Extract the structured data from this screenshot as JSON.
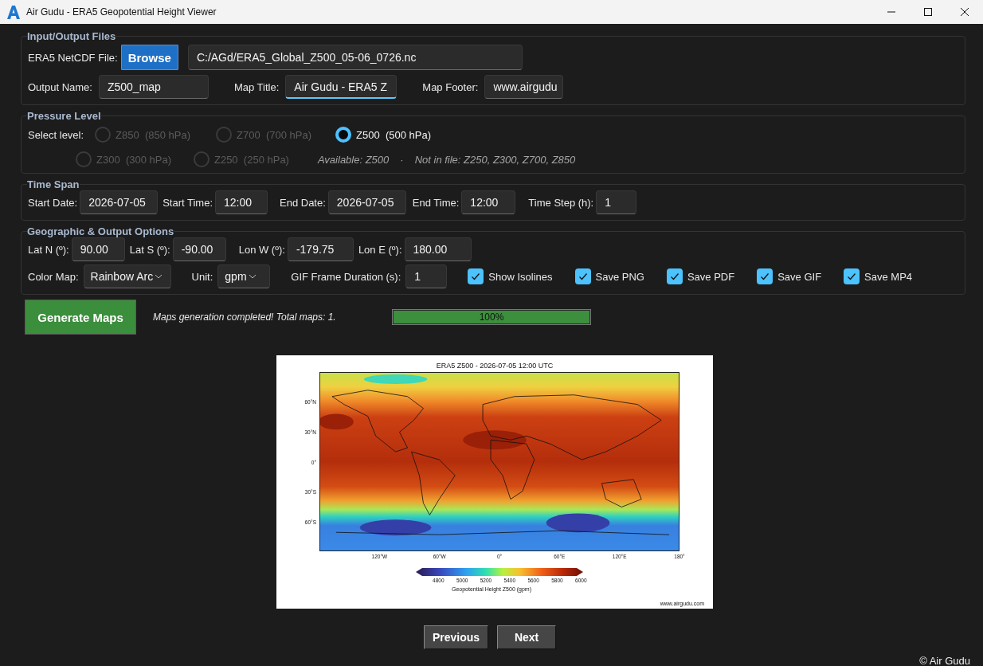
{
  "window": {
    "title": "Air Gudu - ERA5 Geopotential Height Viewer"
  },
  "input_output": {
    "title": "Input/Output Files",
    "file_label": "ERA5 NetCDF File:",
    "browse_button": "Browse",
    "file_path": "C:/AGd/ERA5_Global_Z500_05-06_0726.nc",
    "fields": [
      {
        "label": "Output Name:",
        "value": "Z500_map",
        "focused": false
      },
      {
        "label": "Map Title:",
        "value": "Air Gudu  - ERA5 Z",
        "focused": true
      },
      {
        "label": "Map Footer:",
        "value": "www.airgudu",
        "focused": false
      }
    ]
  },
  "pressure_level": {
    "title": "Pressure Level",
    "label": "Select level:",
    "levels": [
      {
        "name": "Z850",
        "hpa": "(850 hPa)",
        "selected": false,
        "disabled": true
      },
      {
        "name": "Z700",
        "hpa": "(700 hPa)",
        "selected": false,
        "disabled": true
      },
      {
        "name": "Z500",
        "hpa": "(500 hPa)",
        "selected": true,
        "disabled": false
      },
      {
        "name": "Z300",
        "hpa": "(300 hPa)",
        "selected": false,
        "disabled": true
      },
      {
        "name": "Z250",
        "hpa": "(250 hPa)",
        "selected": false,
        "disabled": true
      }
    ],
    "available": "Available: Z500",
    "separator": "·",
    "missing": "Not in file: Z250, Z300, Z700, Z850"
  },
  "time_span": {
    "title": "Time Span",
    "fields": [
      {
        "label": "Start Date:",
        "value": "2026-07-05"
      },
      {
        "label": "Start Time:",
        "value": "12:00"
      },
      {
        "label": "End Date:",
        "value": "2026-07-05"
      },
      {
        "label": "End Time:",
        "value": "12:00"
      },
      {
        "label": "Time Step (h):",
        "value": "1"
      }
    ]
  },
  "geographic": {
    "title": "Geographic & Output Options",
    "fields": [
      {
        "label": "Lat N (º):",
        "value": "90.00"
      },
      {
        "label": "Lat S (º):",
        "value": "-90.00"
      },
      {
        "label": "Lon W (º):",
        "value": "-179.75"
      },
      {
        "label": "Lon E (º):",
        "value": "180.00"
      }
    ],
    "color_map": {
      "label": "Color Map:",
      "value": "Rainbow Arc"
    },
    "unit": {
      "label": "Unit:",
      "value": "gpm"
    },
    "gif_duration": {
      "label": "GIF Frame Duration (s):",
      "value": "1"
    },
    "checkboxes": [
      {
        "label": "Show Isolines",
        "checked": true
      },
      {
        "label": "Save PNG",
        "checked": true
      },
      {
        "label": "Save PDF",
        "checked": true
      },
      {
        "label": "Save GIF",
        "checked": true
      },
      {
        "label": "Save MP4",
        "checked": true
      }
    ]
  },
  "generate_button": "Generate Maps",
  "status": "Maps generation completed! Total maps: 1.",
  "progress": {
    "level": 1,
    "reading": "100%"
  },
  "map_image": {
    "title": "ERA5 Z500 - 2026-07-05 12:00 UTC",
    "lat_labels": [
      "60°N",
      "30°N",
      "0°",
      "30°S",
      "60°S"
    ],
    "lon_labels": [
      "120°W",
      "60°W",
      "0°",
      "60°E",
      "120°E",
      "180°"
    ],
    "colorbar_ticks": [
      "4800",
      "5000",
      "5200",
      "5400",
      "5600",
      "5800",
      "6000"
    ],
    "colorbar_label": "Geopotential Height Z500 (gpm)",
    "footer": "www.airgudu.com"
  },
  "nav_buttons": [
    "Previous",
    "Next"
  ],
  "copyright": "© Air Gudu"
}
